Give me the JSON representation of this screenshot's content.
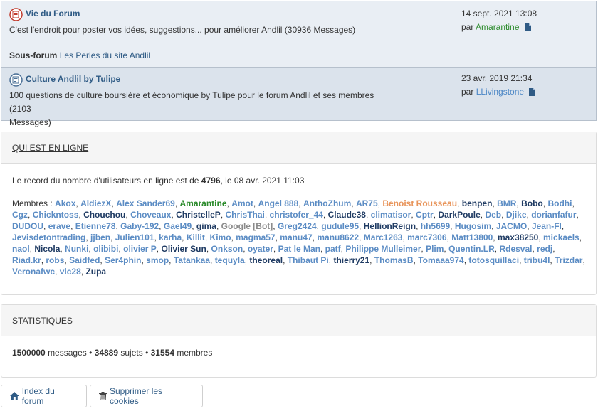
{
  "forums": [
    {
      "title": "Vie du Forum",
      "description": "C'est l'endroit pour poster vos idées, suggestions... pour améliorer Andlil (30936 Messages)",
      "subforum_label": "Sous-forum",
      "subforum_link": "Les Perles du site Andlil",
      "last_date": "14 sept. 2021 13:08",
      "last_by_prefix": "par",
      "last_user": "Amarantine",
      "last_user_color": "#2a8a2a"
    },
    {
      "title": "Culture Andlil by Tulipe",
      "description_l1": "100 questions de culture boursière et économique by Tulipe pour le forum Andlil et ses membres (2103",
      "description_l2": "Messages)",
      "last_date": "23 avr. 2019 21:34",
      "last_by_prefix": "par",
      "last_user": "LLivingstone",
      "last_user_color": "#4a86c5"
    }
  ],
  "online": {
    "heading": "QUI EST EN LIGNE",
    "record_prefix": "Le record du nombre d'utilisateurs en ligne est de",
    "record_value": "4796",
    "record_suffix": ", le 08 avr. 2021 11:03",
    "members_label": "Membres :",
    "members": [
      {
        "n": "Akox",
        "c": "#5b8cc4"
      },
      {
        "n": "AldiezX",
        "c": "#5b8cc4"
      },
      {
        "n": "Alex Sander69",
        "c": "#5b8cc4"
      },
      {
        "n": "Amarantine",
        "c": "#2a8a2a"
      },
      {
        "n": "Amot",
        "c": "#5b8cc4"
      },
      {
        "n": "Angel 888",
        "c": "#5b8cc4"
      },
      {
        "n": "AnthoZhum",
        "c": "#5b8cc4"
      },
      {
        "n": "AR75",
        "c": "#5b8cc4"
      },
      {
        "n": "Benoist Rousseau",
        "c": "#e8945a"
      },
      {
        "n": "benpen",
        "c": "#1f3b63"
      },
      {
        "n": "BMR",
        "c": "#5b8cc4"
      },
      {
        "n": "Bobo",
        "c": "#1f3b63"
      },
      {
        "n": "Bodhi",
        "c": "#5b8cc4"
      },
      {
        "n": "Cgz",
        "c": "#5b8cc4"
      },
      {
        "n": "Chickntoss",
        "c": "#5b8cc4"
      },
      {
        "n": "Chouchou",
        "c": "#1f3b63"
      },
      {
        "n": "Choveaux",
        "c": "#5b8cc4"
      },
      {
        "n": "ChristelleP",
        "c": "#1f3b63"
      },
      {
        "n": "ChrisThai",
        "c": "#5b8cc4"
      },
      {
        "n": "christofer_44",
        "c": "#5b8cc4"
      },
      {
        "n": "Claude38",
        "c": "#1f3b63"
      },
      {
        "n": "climatisor",
        "c": "#5b8cc4"
      },
      {
        "n": "Cptr",
        "c": "#5b8cc4"
      },
      {
        "n": "DarkPoule",
        "c": "#1f3b63"
      },
      {
        "n": "Deb",
        "c": "#5b8cc4"
      },
      {
        "n": "Djike",
        "c": "#5b8cc4"
      },
      {
        "n": "dorianfafur",
        "c": "#5b8cc4"
      },
      {
        "n": "DUDOU",
        "c": "#5b8cc4"
      },
      {
        "n": "erave",
        "c": "#5b8cc4"
      },
      {
        "n": "Etienne78",
        "c": "#5b8cc4"
      },
      {
        "n": "Gaby-192",
        "c": "#5b8cc4"
      },
      {
        "n": "Gael49",
        "c": "#5b8cc4"
      },
      {
        "n": "gima",
        "c": "#1f3b63"
      },
      {
        "n": "Google [Bot]",
        "c": "#8a8a8a"
      },
      {
        "n": "Greg2424",
        "c": "#5b8cc4"
      },
      {
        "n": "gudule95",
        "c": "#5b8cc4"
      },
      {
        "n": "HellionReign",
        "c": "#1f3b63"
      },
      {
        "n": "hh5699",
        "c": "#5b8cc4"
      },
      {
        "n": "Hugosim",
        "c": "#5b8cc4"
      },
      {
        "n": "JACMO",
        "c": "#5b8cc4"
      },
      {
        "n": "Jean-Fl",
        "c": "#5b8cc4"
      },
      {
        "n": "Jevisdetontrading",
        "c": "#5b8cc4"
      },
      {
        "n": "jjben",
        "c": "#5b8cc4"
      },
      {
        "n": "Julien101",
        "c": "#5b8cc4"
      },
      {
        "n": "karha",
        "c": "#5b8cc4"
      },
      {
        "n": "Killit",
        "c": "#5b8cc4"
      },
      {
        "n": "Kimo",
        "c": "#5b8cc4"
      },
      {
        "n": "magma57",
        "c": "#5b8cc4"
      },
      {
        "n": "manu47",
        "c": "#5b8cc4"
      },
      {
        "n": "manu8622",
        "c": "#5b8cc4"
      },
      {
        "n": "Marc1263",
        "c": "#5b8cc4"
      },
      {
        "n": "marc7306",
        "c": "#5b8cc4"
      },
      {
        "n": "Matt13800",
        "c": "#5b8cc4"
      },
      {
        "n": "max38250",
        "c": "#1f3b63"
      },
      {
        "n": "mickaels",
        "c": "#5b8cc4"
      },
      {
        "n": "naol",
        "c": "#5b8cc4"
      },
      {
        "n": "Nicola",
        "c": "#1f3b63"
      },
      {
        "n": "Nunki",
        "c": "#5b8cc4"
      },
      {
        "n": "olibibi",
        "c": "#5b8cc4"
      },
      {
        "n": "olivier P",
        "c": "#5b8cc4"
      },
      {
        "n": "Olivier Sun",
        "c": "#1f3b63"
      },
      {
        "n": "Onkson",
        "c": "#5b8cc4"
      },
      {
        "n": "oyater",
        "c": "#5b8cc4"
      },
      {
        "n": "Pat le Man",
        "c": "#5b8cc4"
      },
      {
        "n": "patf",
        "c": "#5b8cc4"
      },
      {
        "n": "Philippe Mulleimer",
        "c": "#5b8cc4"
      },
      {
        "n": "Plim",
        "c": "#5b8cc4"
      },
      {
        "n": "Quentin.LR",
        "c": "#5b8cc4"
      },
      {
        "n": "Rdesval",
        "c": "#5b8cc4"
      },
      {
        "n": "redj",
        "c": "#5b8cc4"
      },
      {
        "n": "Riad.kr",
        "c": "#5b8cc4"
      },
      {
        "n": "robs",
        "c": "#5b8cc4"
      },
      {
        "n": "Saidfed",
        "c": "#5b8cc4"
      },
      {
        "n": "Ser4phin",
        "c": "#5b8cc4"
      },
      {
        "n": "smop",
        "c": "#5b8cc4"
      },
      {
        "n": "Tatankaa",
        "c": "#5b8cc4"
      },
      {
        "n": "tequyla",
        "c": "#5b8cc4"
      },
      {
        "n": "theoreal",
        "c": "#1f3b63"
      },
      {
        "n": "Thibaut Pi",
        "c": "#5b8cc4"
      },
      {
        "n": "thierry21",
        "c": "#1f3b63"
      },
      {
        "n": "ThomasB",
        "c": "#5b8cc4"
      },
      {
        "n": "Tomaaa974",
        "c": "#5b8cc4"
      },
      {
        "n": "totosquillaci",
        "c": "#5b8cc4"
      },
      {
        "n": "tribu4l",
        "c": "#5b8cc4"
      },
      {
        "n": "Trizdar",
        "c": "#5b8cc4"
      },
      {
        "n": "Veronafwc",
        "c": "#5b8cc4"
      },
      {
        "n": "vlc28",
        "c": "#5b8cc4"
      },
      {
        "n": "Zupa",
        "c": "#1f3b63"
      }
    ]
  },
  "stats": {
    "heading": "STATISTIQUES",
    "messages_value": "1500000",
    "messages_label": "messages",
    "sep": "•",
    "topics_value": "34889",
    "topics_label": "sujets",
    "members_value": "31554",
    "members_label": "membres"
  },
  "footer": {
    "index_label": "Index du forum",
    "cookies_label": "Supprimer les cookies"
  }
}
